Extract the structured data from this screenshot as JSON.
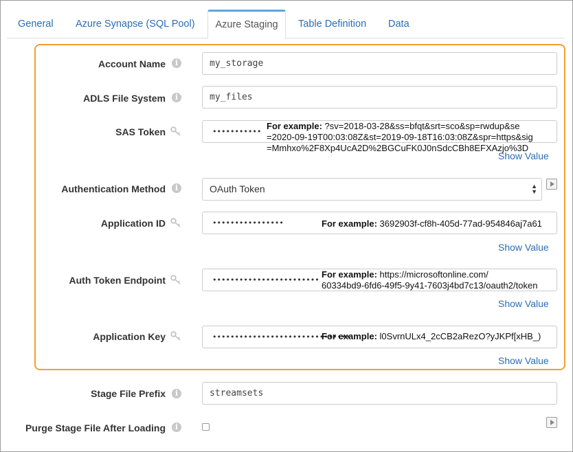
{
  "tabs": [
    {
      "label": "General"
    },
    {
      "label": "Azure Synapse (SQL Pool)"
    },
    {
      "label": "Azure Staging"
    },
    {
      "label": "Table Definition"
    },
    {
      "label": "Data"
    }
  ],
  "active_tab": "Azure Staging",
  "fields": {
    "account_name": {
      "label": "Account Name",
      "value": "my_storage"
    },
    "adls_file_system": {
      "label": "ADLS File System",
      "value": "my_files"
    },
    "sas_token": {
      "label": "SAS Token",
      "masked": "•••••••••••",
      "hint_prefix": "For example:",
      "hint_line1": " ?sv=2018-03-28&ss=bfqt&srt=sco&sp=rwdup&se",
      "hint_line2": "=2020-09-19T00:03:08Z&st=2019-09-18T16:03:08Z&spr=https&sig",
      "hint_line3": "=Mmhxo%2F8Xp4UcA2D%2BGCuFK0J0nSdcCBh8EFXAzjo%3D",
      "show_value": "Show Value"
    },
    "authentication_method": {
      "label": "Authentication Method",
      "value": "OAuth Token"
    },
    "application_id": {
      "label": "Application ID",
      "masked": "••••••••••••••••",
      "hint_prefix": "For example:",
      "hint_line1": " 3692903f-cf8h-405d-77ad-954846aj7a61",
      "show_value": "Show Value"
    },
    "auth_token_endpoint": {
      "label": "Auth Token Endpoint",
      "masked": "••••••••••••••••••••••••",
      "hint_prefix": "For example:",
      "hint_line1": " https://microsoftonline.com/",
      "hint_line2": "60334bd9-6fd6-49f5-9y41-7603j4bd7c13/oauth2/token",
      "show_value": "Show Value"
    },
    "application_key": {
      "label": "Application Key",
      "masked": "•••••••••••••••••••••••••••••••",
      "hint_prefix": "For example:",
      "hint_line1": " l0SvrnULx4_2cCB2aRezO?yJKPf[xHB_)",
      "show_value": "Show Value"
    },
    "stage_file_prefix": {
      "label": "Stage File Prefix",
      "value": "streamsets"
    },
    "purge_stage_file": {
      "label": "Purge Stage File After Loading",
      "checked": false
    }
  },
  "colors": {
    "accent": "#2a6db5",
    "highlight": "#f0a030",
    "tab_indicator": "#5fa6d8"
  }
}
